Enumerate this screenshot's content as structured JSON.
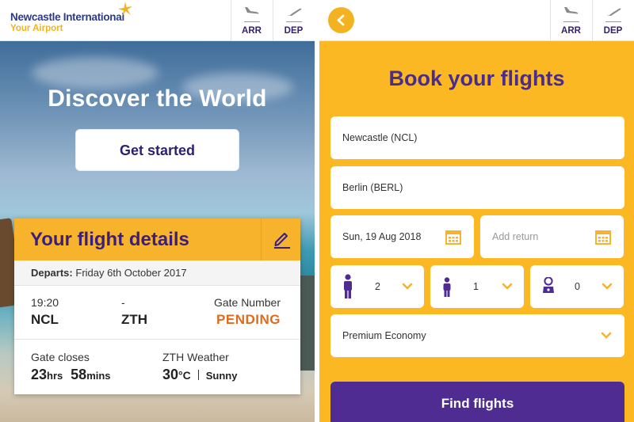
{
  "left_screen": {
    "logo": {
      "line1": "Newcastle International",
      "line2": "Your Airport"
    },
    "nav": {
      "arr_label": "ARR",
      "dep_label": "DEP"
    },
    "hero": {
      "title": "Discover the World",
      "cta_label": "Get started"
    },
    "flight_card": {
      "title": "Your flight details",
      "departs_label": "Departs:",
      "departs_value": "Friday 6th October 2017",
      "time": "19:20",
      "dash": "-",
      "gate_label": "Gate Number",
      "origin": "NCL",
      "destination": "ZTH",
      "gate_status": "PENDING",
      "gate_closes_label": "Gate closes",
      "hours": "23",
      "hours_unit": "hrs",
      "minutes": "58",
      "minutes_unit": "mins",
      "weather_label": "ZTH Weather",
      "temperature": "30",
      "temp_unit": "°C",
      "weather_condition": "Sunny"
    }
  },
  "right_screen": {
    "nav": {
      "arr_label": "ARR",
      "dep_label": "DEP"
    },
    "title": "Book your flights",
    "from": "Newcastle (NCL)",
    "to": "Berlin (BERL)",
    "depart_date": "Sun, 19 Aug 2018",
    "return_placeholder": "Add return",
    "adults": "2",
    "children": "1",
    "infants": "0",
    "cabin_class": "Premium Economy",
    "find_label": "Find flights"
  },
  "colors": {
    "brand_navy": "#2b3a8c",
    "brand_yellow": "#f0b322",
    "accent_orange": "#fbb823",
    "purple": "#4f2c92",
    "pending": "#e06b1f"
  },
  "icons": [
    "star-logo-icon",
    "arrivals-plane-icon",
    "departures-plane-icon",
    "edit-pencil-icon",
    "back-arrow-icon",
    "calendar-icon",
    "adult-icon",
    "child-icon",
    "infant-icon",
    "chevron-down-icon"
  ]
}
